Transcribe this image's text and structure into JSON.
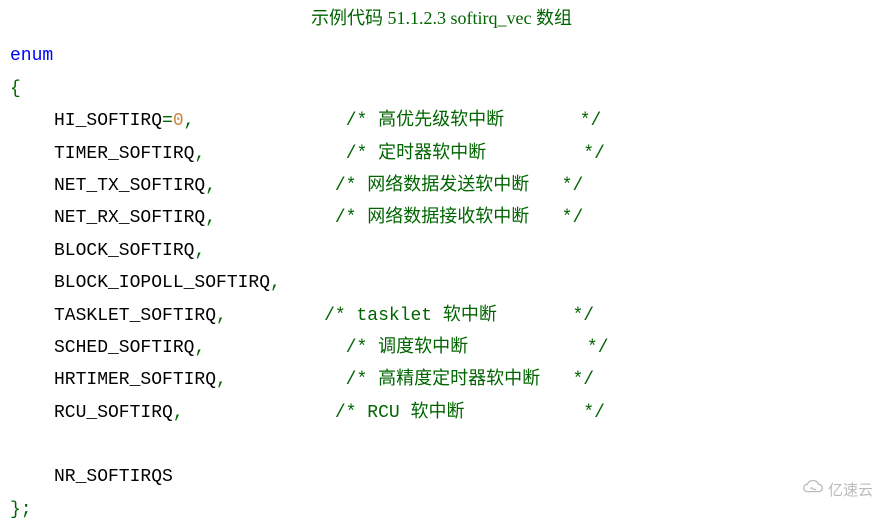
{
  "title": "示例代码 51.1.2.3 softirq_vec 数组",
  "enum_kw": "enum",
  "open_brace": "{",
  "close_brace": "};",
  "lines": [
    {
      "name": "HI_SOFTIRQ",
      "assign": "=",
      "value": "0",
      "comma": ",",
      "gap": "              ",
      "comment": "/* 高优先级软中断       */"
    },
    {
      "name": "TIMER_SOFTIRQ",
      "assign": "",
      "value": "",
      "comma": ",",
      "gap": "             ",
      "comment": "/* 定时器软中断         */"
    },
    {
      "name": "NET_TX_SOFTIRQ",
      "assign": "",
      "value": "",
      "comma": ",",
      "gap": "           ",
      "comment": "/* 网络数据发送软中断   */"
    },
    {
      "name": "NET_RX_SOFTIRQ",
      "assign": "",
      "value": "",
      "comma": ",",
      "gap": "           ",
      "comment": "/* 网络数据接收软中断   */"
    },
    {
      "name": "BLOCK_SOFTIRQ",
      "assign": "",
      "value": "",
      "comma": ",",
      "gap": "",
      "comment": ""
    },
    {
      "name": "BLOCK_IOPOLL_SOFTIRQ",
      "assign": "",
      "value": "",
      "comma": ",",
      "gap": "",
      "comment": ""
    },
    {
      "name": "TASKLET_SOFTIRQ",
      "assign": "",
      "value": "",
      "comma": ",",
      "gap": "         ",
      "comment": "/* tasklet 软中断       */"
    },
    {
      "name": "SCHED_SOFTIRQ",
      "assign": "",
      "value": "",
      "comma": ",",
      "gap": "             ",
      "comment": "/* 调度软中断           */"
    },
    {
      "name": "HRTIMER_SOFTIRQ",
      "assign": "",
      "value": "",
      "comma": ",",
      "gap": "           ",
      "comment": "/* 高精度定时器软中断   */"
    },
    {
      "name": "RCU_SOFTIRQ",
      "assign": "",
      "value": "",
      "comma": ",",
      "gap": "              ",
      "comment": "/* RCU 软中断           */"
    },
    {
      "name": "",
      "assign": "",
      "value": "",
      "comma": "",
      "gap": "",
      "comment": ""
    },
    {
      "name": "NR_SOFTIRQS",
      "assign": "",
      "value": "",
      "comma": "",
      "gap": "",
      "comment": ""
    }
  ],
  "watermark": "亿速云"
}
